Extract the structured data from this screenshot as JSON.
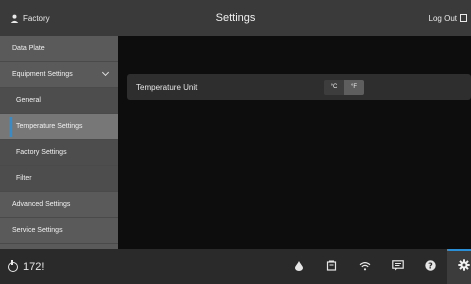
{
  "header": {
    "user_label": "Factory",
    "title": "Settings",
    "logout_label": "Log Out"
  },
  "sidebar": {
    "items": [
      {
        "label": "Data Plate"
      },
      {
        "label": "Equipment Settings"
      },
      {
        "label": "General"
      },
      {
        "label": "Temperature Settings"
      },
      {
        "label": "Factory Settings"
      },
      {
        "label": "Filter"
      },
      {
        "label": "Advanced Settings"
      },
      {
        "label": "Service Settings"
      }
    ]
  },
  "main": {
    "temperature_unit": {
      "label": "Temperature Unit",
      "options": [
        "°C",
        "°F"
      ],
      "selected": "°F"
    }
  },
  "footer": {
    "status_value": "172!",
    "icons": [
      "water-drop-icon",
      "appliance-icon",
      "wifi-icon",
      "message-icon",
      "help-icon",
      "settings-gear-icon"
    ],
    "active_icon": "settings-gear-icon"
  },
  "colors": {
    "accent": "#2a8fd6",
    "sidebar": "#5a5a5a",
    "header": "#3a3a3a",
    "content_background": "#0d0d0d"
  }
}
